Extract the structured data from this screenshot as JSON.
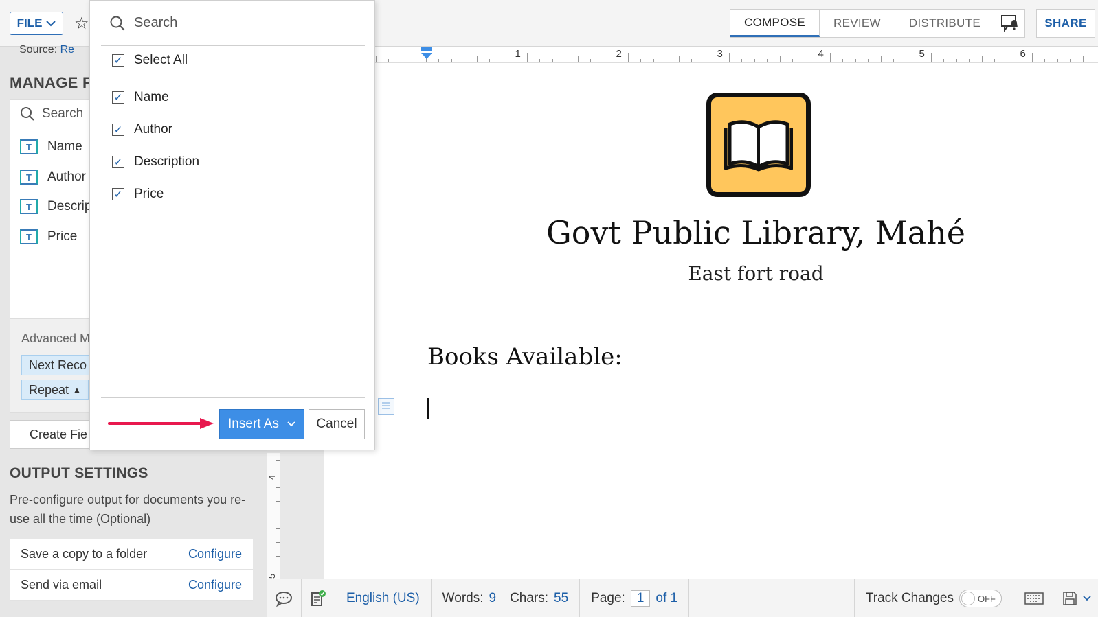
{
  "toolbar": {
    "file_label": "FILE",
    "tabs": [
      {
        "label": "COMPOSE",
        "active": true
      },
      {
        "label": "REVIEW",
        "active": false
      },
      {
        "label": "DISTRIBUTE",
        "active": false
      }
    ],
    "share_label": "SHARE",
    "accent_color": "#2f6fb7"
  },
  "left_panel": {
    "source_label": "Source:",
    "source_link": "Re",
    "manage_heading": "MANAGE F",
    "search_placeholder": "Search",
    "fields": [
      {
        "label": "Name"
      },
      {
        "label": "Author"
      },
      {
        "label": "Descrip"
      },
      {
        "label": "Price"
      }
    ],
    "advanced_title": "Advanced M",
    "next_record_chip": "Next Reco",
    "repeat_chip": "Repeat",
    "create_button": "Create Fie",
    "output_heading": "OUTPUT SETTINGS",
    "output_desc": "Pre-configure output for documents you re-use all the time (Optional)",
    "config_rows": [
      {
        "label": "Save a copy to a folder",
        "link": "Configure"
      },
      {
        "label": "Send via email",
        "link": "Configure"
      }
    ]
  },
  "dropdown": {
    "search_placeholder": "Search",
    "select_all": "Select All",
    "items": [
      {
        "label": "Name",
        "checked": true
      },
      {
        "label": "Author",
        "checked": true
      },
      {
        "label": "Description",
        "checked": true
      },
      {
        "label": "Price",
        "checked": true
      }
    ],
    "insert_label": "Insert As",
    "cancel_label": "Cancel"
  },
  "ruler": {
    "numbers": [
      "1",
      "2",
      "3",
      "4",
      "5",
      "6"
    ],
    "vertical_numbers": [
      "4",
      "5"
    ]
  },
  "document": {
    "title": "Govt Public Library, Mahé",
    "subtitle": "East fort road",
    "heading": "Books Available:",
    "logo_color": "#ffc65c"
  },
  "status": {
    "language": "English (US)",
    "words_label": "Words:",
    "words_value": "9",
    "chars_label": "Chars:",
    "chars_value": "55",
    "page_label": "Page:",
    "page_value": "1",
    "page_of": "of 1",
    "track_changes_label": "Track Changes",
    "track_changes_state": "OFF"
  }
}
